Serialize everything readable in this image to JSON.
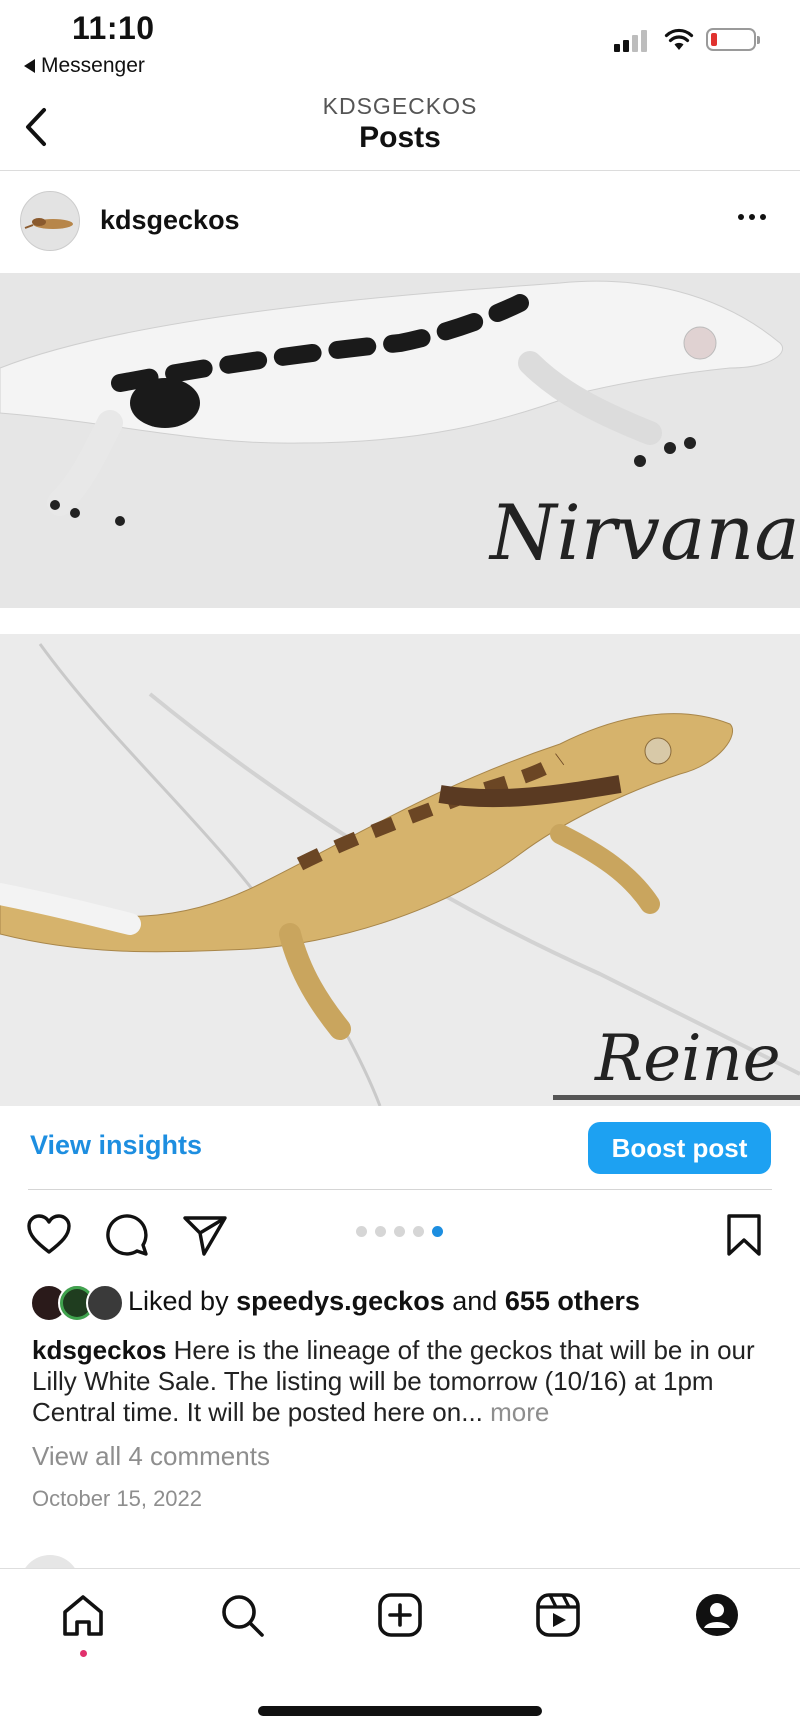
{
  "status_bar": {
    "time": "11:10",
    "back_app": "Messenger",
    "battery_color": "#e0322f"
  },
  "header": {
    "account": "KDSGECKOS",
    "title": "Posts",
    "back_icon": "chevron-left-icon"
  },
  "post": {
    "username": "kdsgeckos",
    "more_icon": "more-horizontal-icon",
    "photos": [
      {
        "signature": "Nirvana"
      },
      {
        "signature": "Reine"
      }
    ],
    "view_insights": "View insights",
    "boost_post": "Boost post",
    "carousel": {
      "count": 5,
      "active_index": 4
    },
    "liked_by_prefix": "Liked by",
    "liked_by_user": "speedys.geckos",
    "liked_by_and": "and",
    "liked_by_others": "655 others",
    "caption_user": "kdsgeckos",
    "caption_text": "Here is the lineage of the geckos that will be in our Lilly White Sale. The listing will be tomorrow (10/16) at 1pm Central time. It will be posted here on...",
    "caption_more": "more",
    "view_comments": "View all 4 comments",
    "date": "October 15, 2022"
  },
  "accent_color": "#1d8ee0",
  "tabs": [
    "home-icon",
    "search-icon",
    "create-post-icon",
    "reels-icon",
    "profile-icon"
  ]
}
